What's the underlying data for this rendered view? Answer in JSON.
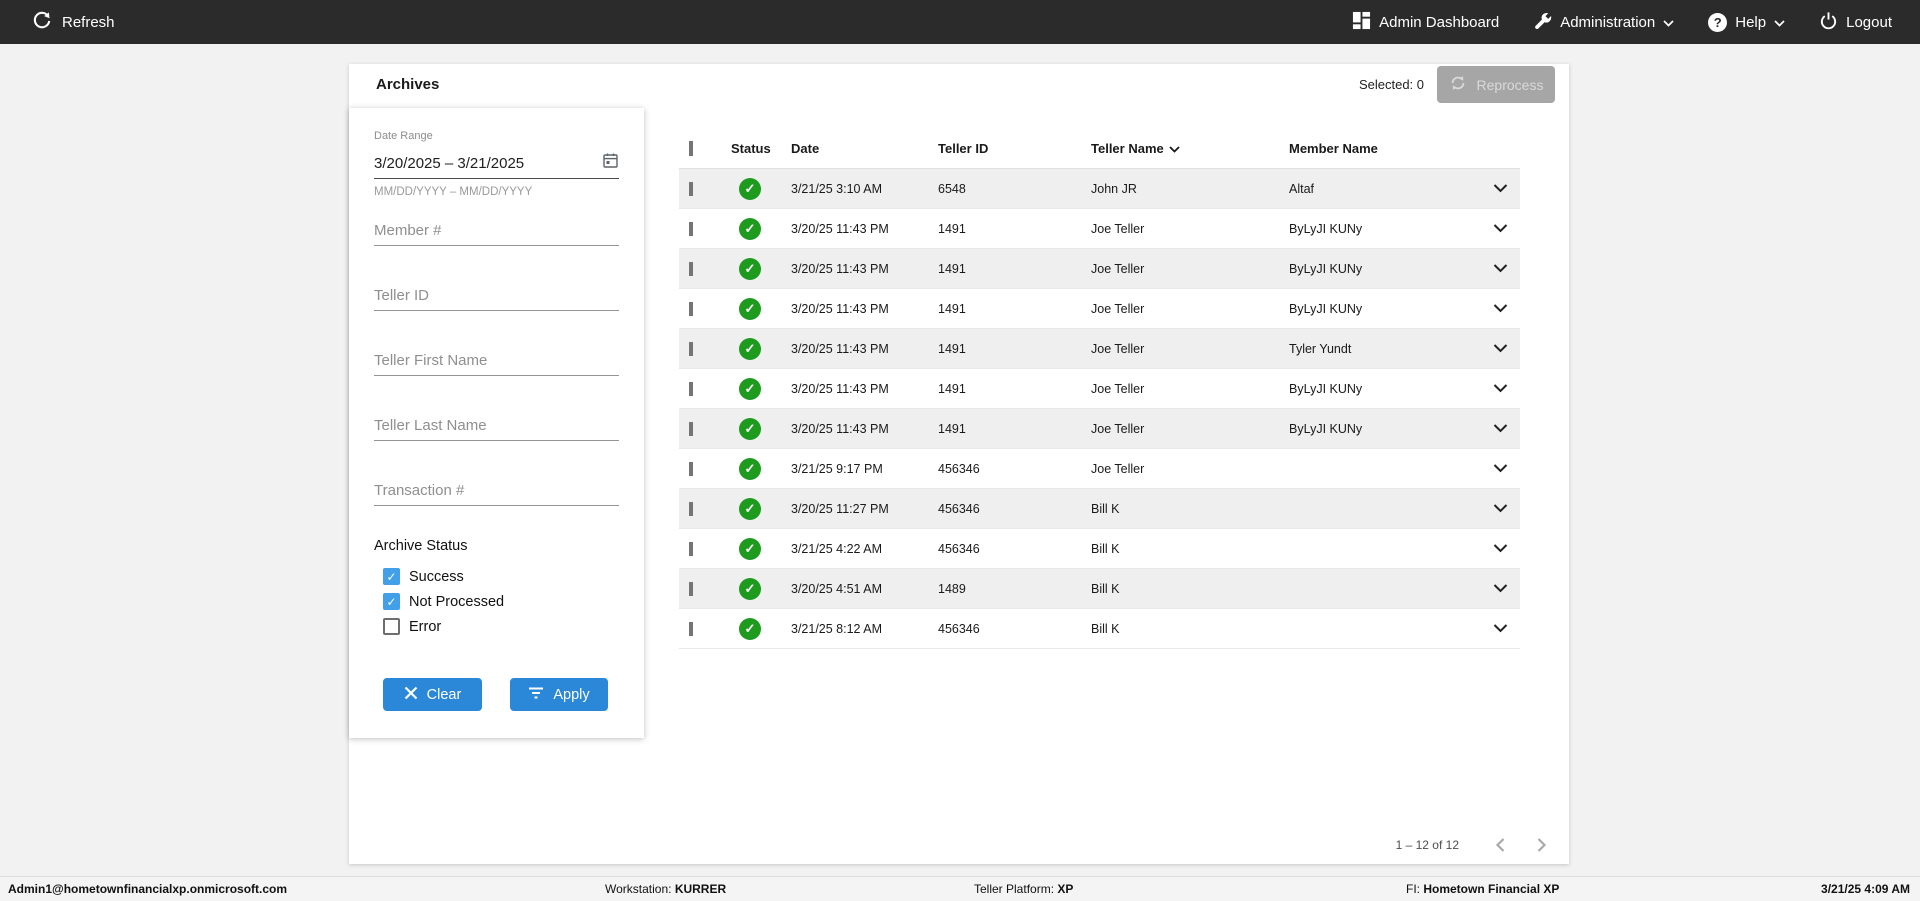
{
  "topbar": {
    "refresh_label": "Refresh",
    "admin_dashboard_label": "Admin Dashboard",
    "administration_label": "Administration",
    "help_label": "Help",
    "logout_label": "Logout"
  },
  "archives_header": {
    "title": "Archives",
    "selected_label": "Selected: 0",
    "reprocess_label": "Reprocess"
  },
  "filters": {
    "date_range": {
      "label": "Date Range",
      "value": "3/20/2025 – 3/21/2025",
      "hint": "MM/DD/YYYY – MM/DD/YYYY"
    },
    "text_fields": [
      {
        "name": "member-number",
        "placeholder": "Member #"
      },
      {
        "name": "teller-id",
        "placeholder": "Teller ID"
      },
      {
        "name": "teller-first-name",
        "placeholder": "Teller First Name"
      },
      {
        "name": "teller-last-name",
        "placeholder": "Teller Last Name"
      },
      {
        "name": "transaction-number",
        "placeholder": "Transaction #"
      }
    ],
    "archive_status": {
      "label": "Archive Status",
      "options": [
        {
          "label": "Success",
          "checked": true
        },
        {
          "label": "Not Processed",
          "checked": true
        },
        {
          "label": "Error",
          "checked": false
        }
      ]
    },
    "clear_label": "Clear",
    "apply_label": "Apply"
  },
  "table": {
    "columns": [
      "Status",
      "Date",
      "Teller ID",
      "Teller Name",
      "Member Name"
    ],
    "sort": {
      "column": "Teller Name",
      "direction": "desc"
    },
    "rows": [
      {
        "status": "success",
        "date": "3/21/25 3:10 AM",
        "teller_id": "6548",
        "teller_name": "John JR",
        "member_name": "Altaf"
      },
      {
        "status": "success",
        "date": "3/20/25 11:43 PM",
        "teller_id": "1491",
        "teller_name": "Joe Teller",
        "member_name": "ByLyJI KUNy"
      },
      {
        "status": "success",
        "date": "3/20/25 11:43 PM",
        "teller_id": "1491",
        "teller_name": "Joe Teller",
        "member_name": "ByLyJI KUNy"
      },
      {
        "status": "success",
        "date": "3/20/25 11:43 PM",
        "teller_id": "1491",
        "teller_name": "Joe Teller",
        "member_name": "ByLyJI KUNy"
      },
      {
        "status": "success",
        "date": "3/20/25 11:43 PM",
        "teller_id": "1491",
        "teller_name": "Joe Teller",
        "member_name": "Tyler Yundt"
      },
      {
        "status": "success",
        "date": "3/20/25 11:43 PM",
        "teller_id": "1491",
        "teller_name": "Joe Teller",
        "member_name": "ByLyJI KUNy"
      },
      {
        "status": "success",
        "date": "3/20/25 11:43 PM",
        "teller_id": "1491",
        "teller_name": "Joe Teller",
        "member_name": "ByLyJI KUNy"
      },
      {
        "status": "success",
        "date": "3/21/25 9:17 PM",
        "teller_id": "456346",
        "teller_name": "Joe Teller",
        "member_name": ""
      },
      {
        "status": "success",
        "date": "3/20/25 11:27 PM",
        "teller_id": "456346",
        "teller_name": "Bill K",
        "member_name": ""
      },
      {
        "status": "success",
        "date": "3/21/25 4:22 AM",
        "teller_id": "456346",
        "teller_name": "Bill K",
        "member_name": ""
      },
      {
        "status": "success",
        "date": "3/20/25 4:51 AM",
        "teller_id": "1489",
        "teller_name": "Bill K",
        "member_name": ""
      },
      {
        "status": "success",
        "date": "3/21/25 8:12 AM",
        "teller_id": "456346",
        "teller_name": "Bill K",
        "member_name": ""
      }
    ],
    "pagination": {
      "range_label": "1 – 12 of 12"
    }
  },
  "statusbar": {
    "user": "Admin1@hometownfinancialxp.onmicrosoft.com",
    "workstation_label": "Workstation:",
    "workstation_value": "KURRER",
    "teller_platform_label": "Teller Platform:",
    "teller_platform_value": "XP",
    "fi_label": "FI:",
    "fi_value": "Hometown Financial XP",
    "datetime": "3/21/25 4:09 AM"
  },
  "colors": {
    "topbar_bg": "#2b2b2b",
    "accent_blue": "#2b87d8",
    "checkbox_blue": "#42a0e8",
    "success_green": "#1e9b1e",
    "disabled_button_gray": "#a6a6a6",
    "row_stripe_gray": "#efefef"
  }
}
